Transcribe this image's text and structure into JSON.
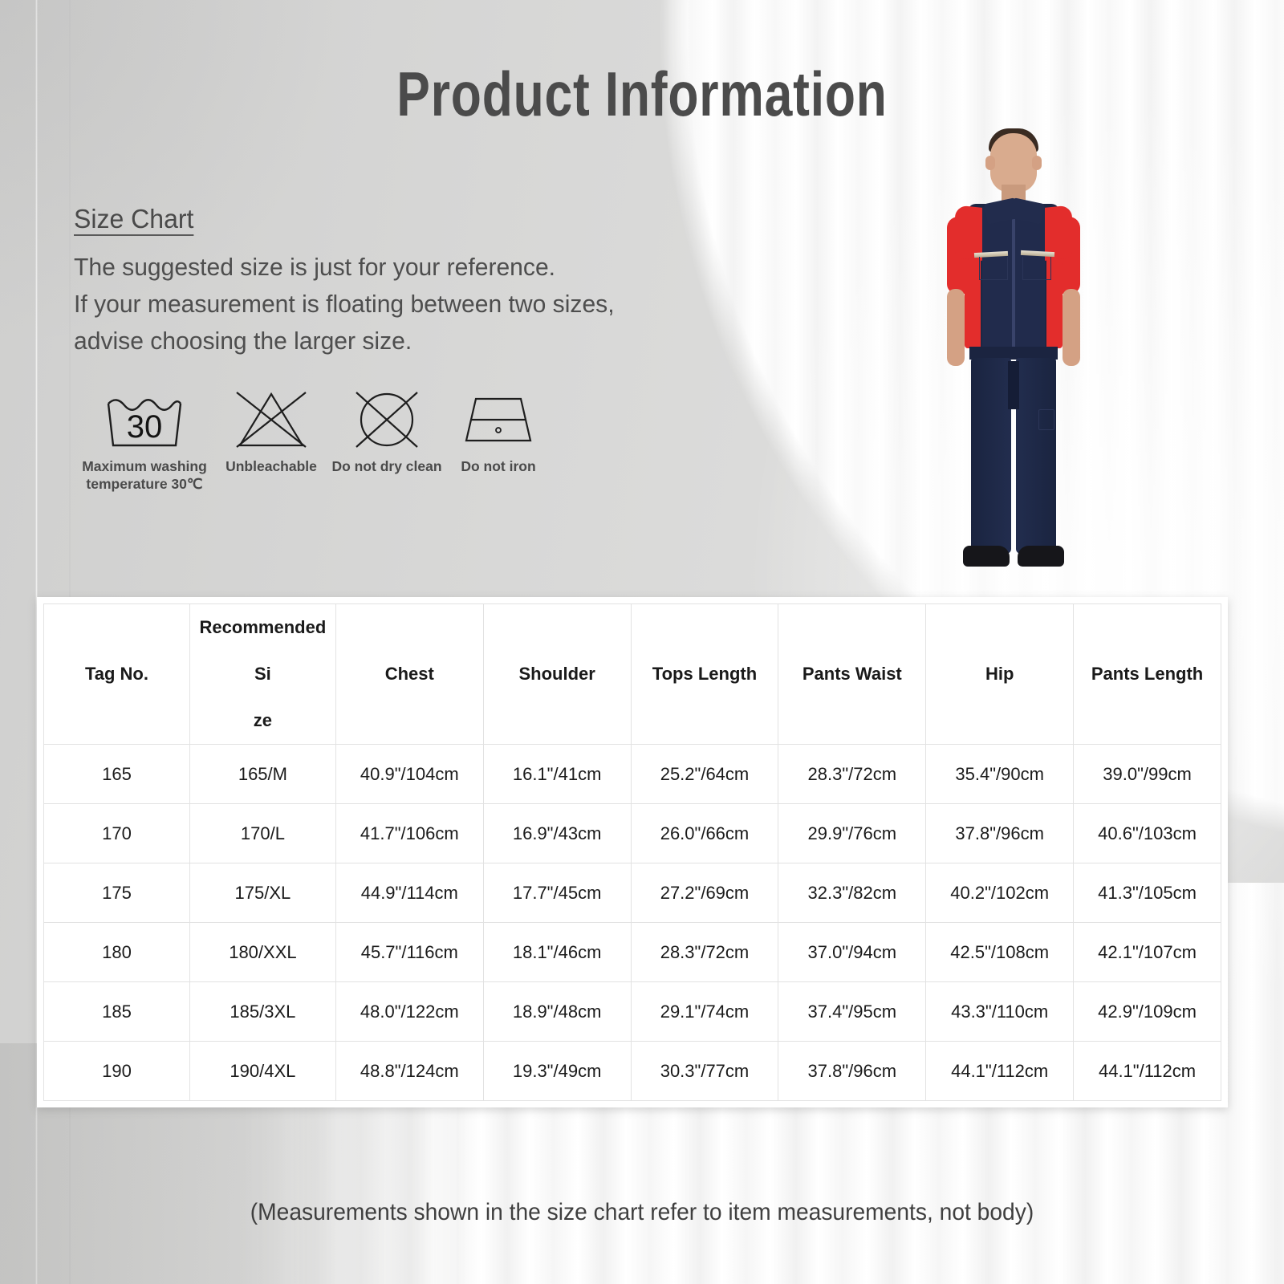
{
  "page": {
    "title": "Product  Information",
    "footer_note": "(Measurements shown in the size chart refer to item measurements, not body)"
  },
  "size_chart_info": {
    "heading": "Size Chart",
    "lines": [
      "The suggested size is just for your reference.",
      "If your measurement is floating between two sizes,",
      "advise choosing the larger size."
    ]
  },
  "care_symbols": [
    {
      "icon": "wash-tub-30-icon",
      "label": "Maximum washing\ntemperature 30℃"
    },
    {
      "icon": "crossed-triangle-icon",
      "label": "Unbleachable"
    },
    {
      "icon": "crossed-circle-icon",
      "label": "Do not dry clean"
    },
    {
      "icon": "iron-icon",
      "label": "Do not iron"
    }
  ],
  "product_photo": {
    "alt": "male-model-wearing-red-and-navy-work-uniform",
    "top_color": "#e32d2c",
    "body_color": "#1e2744",
    "stripe_color": "#e8e2d2",
    "shoe_color": "#16161a"
  },
  "table": {
    "headers": [
      "Tag No.",
      "Recommended Si\nze",
      "Chest",
      "Shoulder",
      "Tops Length",
      "Pants Waist",
      "Hip",
      "Pants Length"
    ],
    "rows": [
      {
        "tag_no": "165",
        "recommended_size": "165/M",
        "chest": "40.9\"/104cm",
        "shoulder": "16.1\"/41cm",
        "tops_length": "25.2\"/64cm",
        "pants_waist": "28.3\"/72cm",
        "hip": "35.4\"/90cm",
        "pants_length": "39.0\"/99cm"
      },
      {
        "tag_no": "170",
        "recommended_size": "170/L",
        "chest": "41.7\"/106cm",
        "shoulder": "16.9\"/43cm",
        "tops_length": "26.0\"/66cm",
        "pants_waist": "29.9\"/76cm",
        "hip": "37.8\"/96cm",
        "pants_length": "40.6\"/103cm"
      },
      {
        "tag_no": "175",
        "recommended_size": "175/XL",
        "chest": "44.9\"/114cm",
        "shoulder": "17.7\"/45cm",
        "tops_length": "27.2\"/69cm",
        "pants_waist": "32.3\"/82cm",
        "hip": "40.2\"/102cm",
        "pants_length": "41.3\"/105cm"
      },
      {
        "tag_no": "180",
        "recommended_size": "180/XXL",
        "chest": "45.7\"/116cm",
        "shoulder": "18.1\"/46cm",
        "tops_length": "28.3\"/72cm",
        "pants_waist": "37.0\"/94cm",
        "hip": "42.5\"/108cm",
        "pants_length": "42.1\"/107cm"
      },
      {
        "tag_no": "185",
        "recommended_size": "185/3XL",
        "chest": "48.0\"/122cm",
        "shoulder": "18.9\"/48cm",
        "tops_length": "29.1\"/74cm",
        "pants_waist": "37.4\"/95cm",
        "hip": "43.3\"/110cm",
        "pants_length": "42.9\"/109cm"
      },
      {
        "tag_no": "190",
        "recommended_size": "190/4XL",
        "chest": "48.8\"/124cm",
        "shoulder": "19.3\"/49cm",
        "tops_length": "30.3\"/77cm",
        "pants_waist": "37.8\"/96cm",
        "hip": "44.1\"/112cm",
        "pants_length": "44.1\"/112cm"
      }
    ]
  },
  "colors": {
    "background_wall": "#d6d6d5",
    "curtain": "#ffffff",
    "title_text": "#4b4b4b",
    "body_text": "#4e4e4e",
    "table_text": "#1a1a1a",
    "table_border": "#e2e2e2"
  }
}
